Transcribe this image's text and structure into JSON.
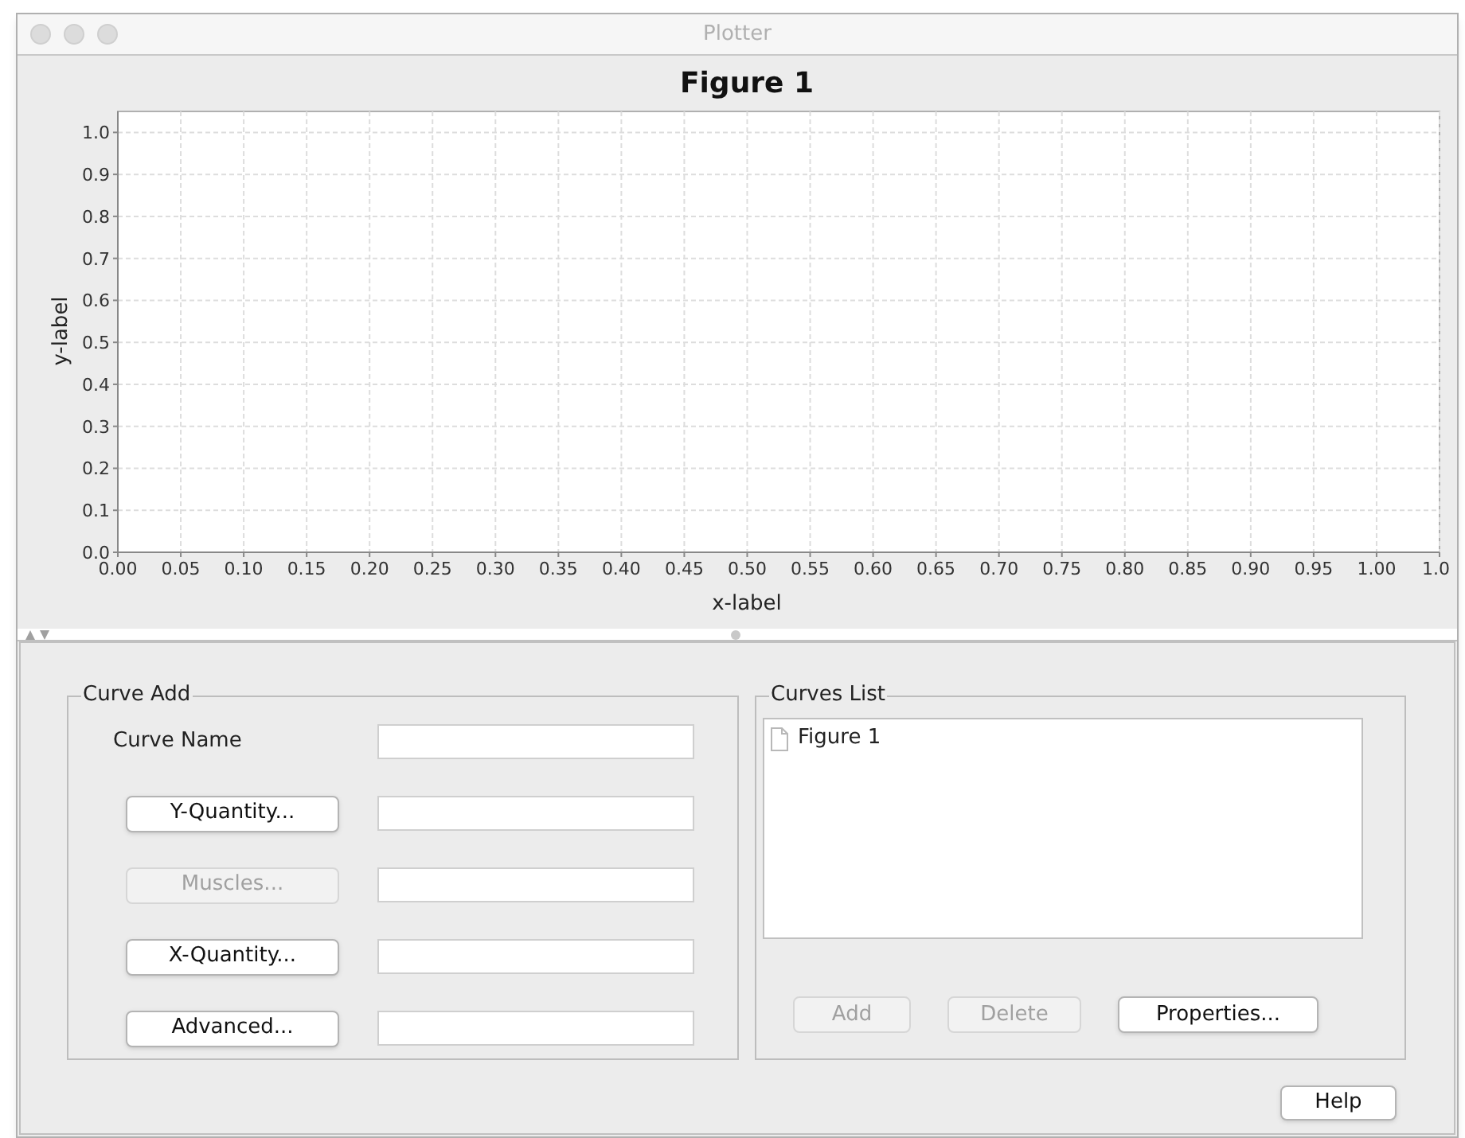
{
  "window": {
    "title": "Plotter"
  },
  "figure": {
    "chart_data": {
      "type": "line",
      "title": "Figure 1",
      "xlabel": "x-label",
      "ylabel": "y-label",
      "xlim": [
        0,
        1.05
      ],
      "ylim": [
        0,
        1.05
      ],
      "grid": true,
      "xticks": [
        {
          "value": 0,
          "label": "0.00"
        },
        {
          "value": 0.05,
          "label": "0.05"
        },
        {
          "value": 0.1,
          "label": "0.10"
        },
        {
          "value": 0.15,
          "label": "0.15"
        },
        {
          "value": 0.2,
          "label": "0.20"
        },
        {
          "value": 0.25,
          "label": "0.25"
        },
        {
          "value": 0.3,
          "label": "0.30"
        },
        {
          "value": 0.35,
          "label": "0.35"
        },
        {
          "value": 0.4,
          "label": "0.40"
        },
        {
          "value": 0.45,
          "label": "0.45"
        },
        {
          "value": 0.5,
          "label": "0.50"
        },
        {
          "value": 0.55,
          "label": "0.55"
        },
        {
          "value": 0.6,
          "label": "0.60"
        },
        {
          "value": 0.65,
          "label": "0.65"
        },
        {
          "value": 0.7,
          "label": "0.70"
        },
        {
          "value": 0.75,
          "label": "0.75"
        },
        {
          "value": 0.8,
          "label": "0.80"
        },
        {
          "value": 0.85,
          "label": "0.85"
        },
        {
          "value": 0.9,
          "label": "0.90"
        },
        {
          "value": 0.95,
          "label": "0.95"
        },
        {
          "value": 1,
          "label": "1.00"
        },
        {
          "value": 1.05,
          "label": "1.0"
        }
      ],
      "yticks": [
        {
          "value": 0,
          "label": "0.0"
        },
        {
          "value": 0.1,
          "label": "0.1"
        },
        {
          "value": 0.2,
          "label": "0.2"
        },
        {
          "value": 0.3,
          "label": "0.3"
        },
        {
          "value": 0.4,
          "label": "0.4"
        },
        {
          "value": 0.5,
          "label": "0.5"
        },
        {
          "value": 0.6,
          "label": "0.6"
        },
        {
          "value": 0.7,
          "label": "0.7"
        },
        {
          "value": 0.8,
          "label": "0.8"
        },
        {
          "value": 0.9,
          "label": "0.9"
        },
        {
          "value": 1,
          "label": "1.0"
        }
      ]
    }
  },
  "curve_add": {
    "title": "Curve Add",
    "rows": [
      {
        "kind": "label",
        "label": "Curve Name"
      },
      {
        "kind": "button",
        "label": "Y-Quantity...",
        "disabled": false
      },
      {
        "kind": "button",
        "label": "Muscles...",
        "disabled": true
      },
      {
        "kind": "button",
        "label": "X-Quantity...",
        "disabled": false
      },
      {
        "kind": "button",
        "label": "Advanced...",
        "disabled": false
      }
    ]
  },
  "curves_list": {
    "title": "Curves List",
    "items": [
      {
        "label": "Figure 1",
        "selected": false
      }
    ],
    "buttons": [
      {
        "label": "Add",
        "disabled": true
      },
      {
        "label": "Delete",
        "disabled": true
      },
      {
        "label": "Properties...",
        "disabled": false
      }
    ]
  },
  "help_button": {
    "label": "Help"
  }
}
